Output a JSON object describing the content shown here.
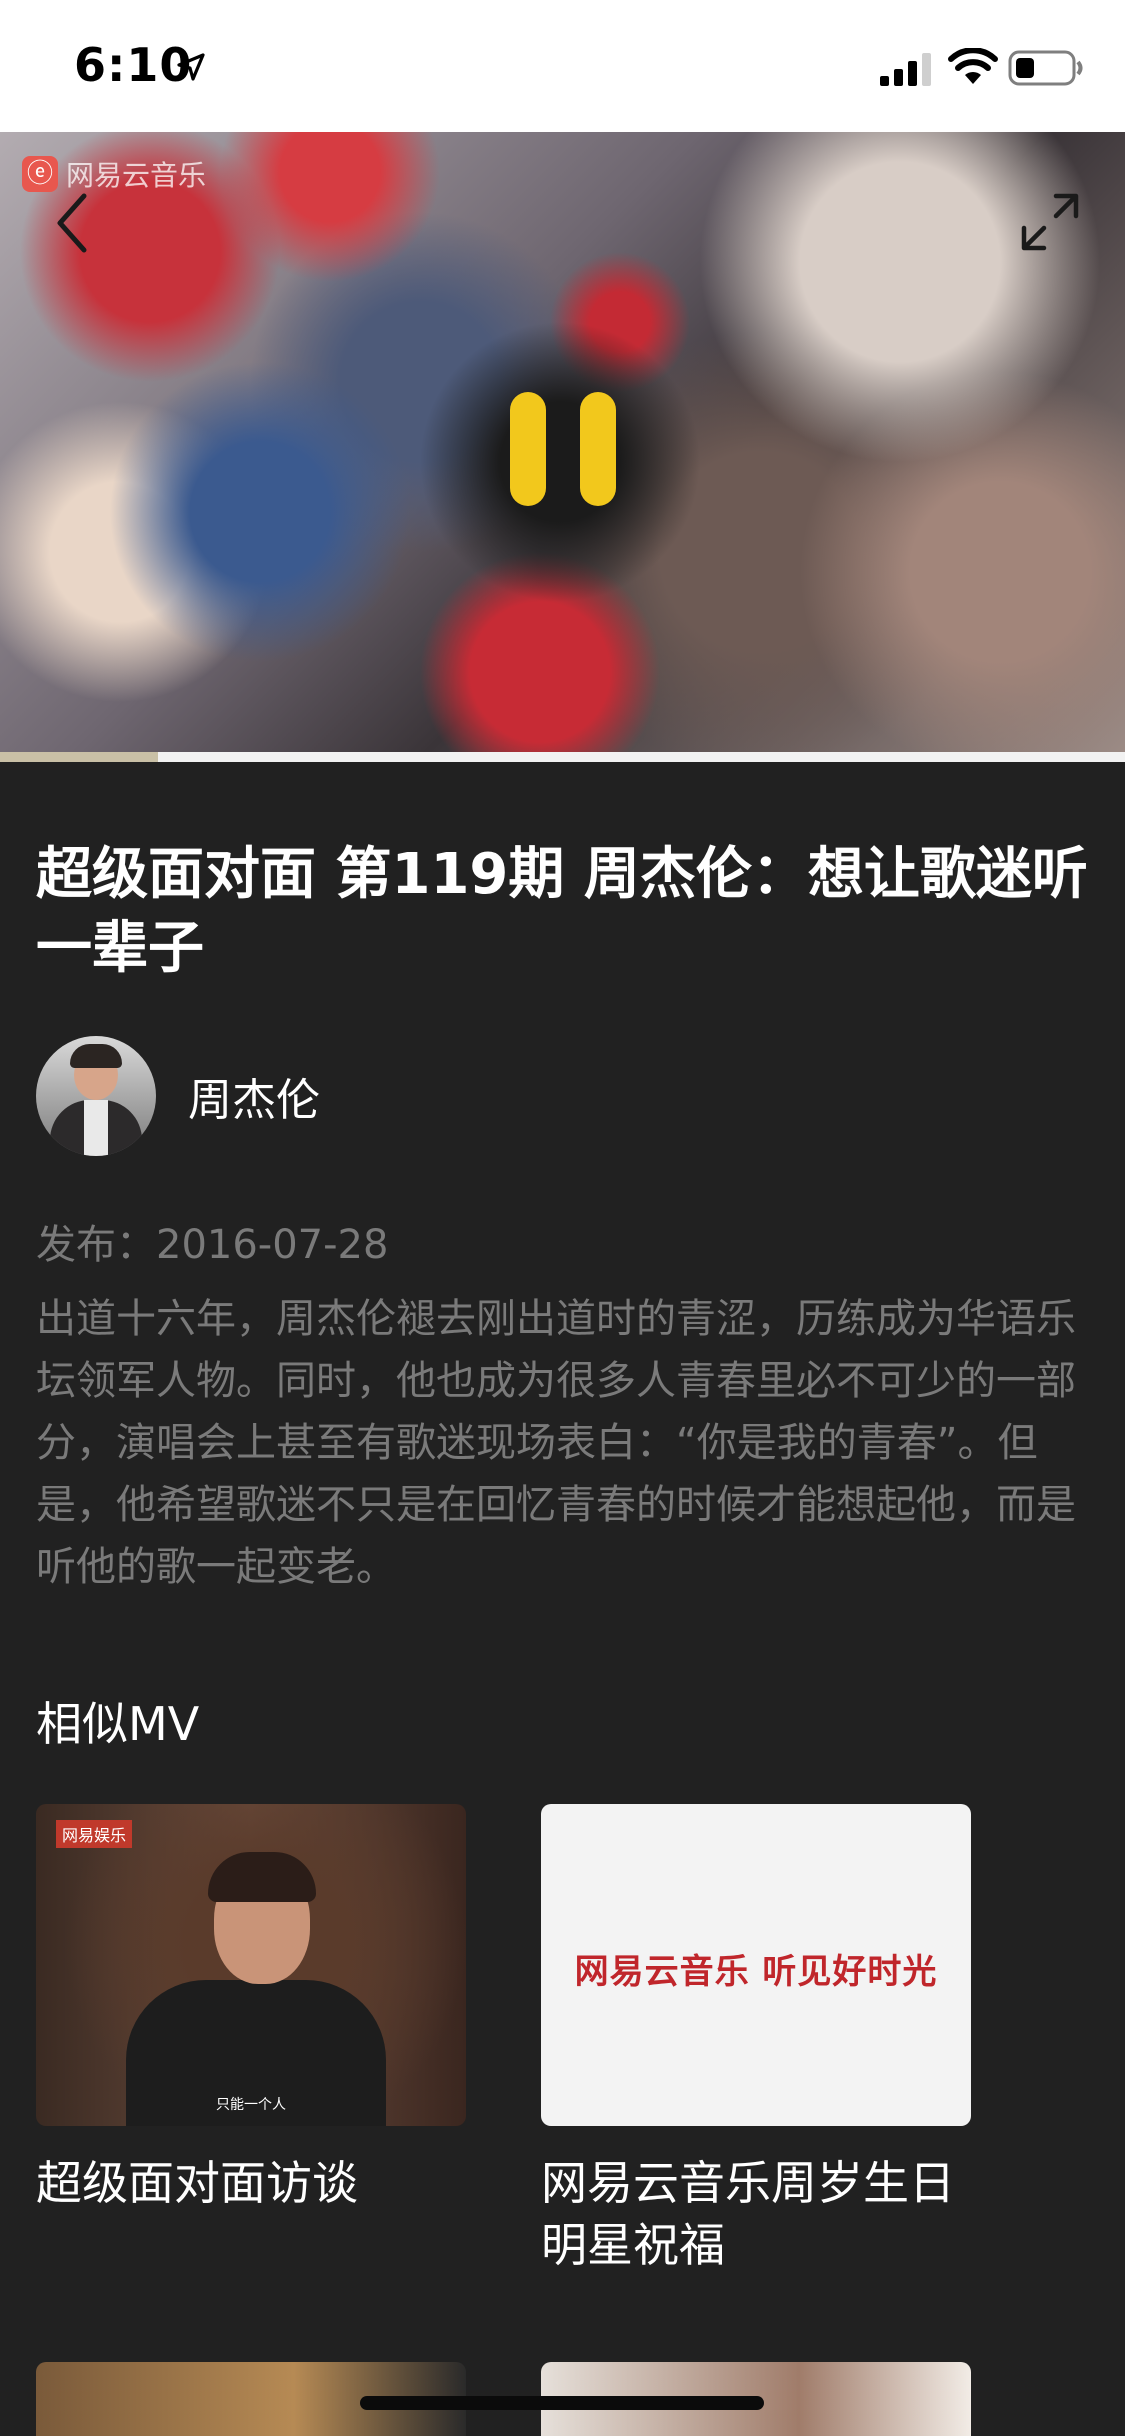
{
  "status_bar": {
    "time": "6:10",
    "icons": [
      "location-arrow-icon",
      "cellular-signal-icon",
      "wifi-icon",
      "battery-icon"
    ]
  },
  "player": {
    "watermark": "网易云音乐",
    "icons": [
      "back-icon",
      "fullscreen-icon",
      "pause-icon"
    ],
    "accent_color": "#f2c81c",
    "progress": 0.14
  },
  "video": {
    "title": "超级面对面 第119期 周杰伦：想让歌迷听一辈子",
    "artist": "周杰伦",
    "publish_date": "发布：2016-07-28",
    "description": "出道十六年，周杰伦褪去刚出道时的青涩，历练成为华语乐坛领军人物。同时，他也成为很多人青春里必不可少的一部分，演唱会上甚至有歌迷现场表白：“你是我的青春”。但是，他希望歌迷不只是在回忆青春的时候才能想起他，而是听他的歌一起变老。"
  },
  "similar": {
    "title": "相似MV",
    "items": [
      {
        "caption": "超级面对面访谈",
        "thumb_tag": "网易娱乐",
        "thumb_subtitle": "只能一个人"
      },
      {
        "caption": "网易云音乐周岁生日明星祝福",
        "thumb_text": "网易云音乐 听见好时光"
      }
    ]
  }
}
